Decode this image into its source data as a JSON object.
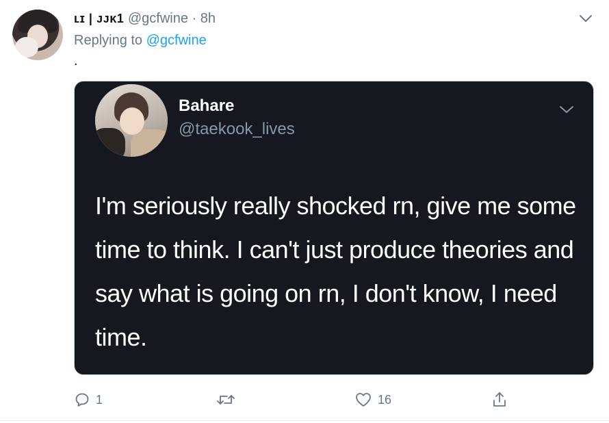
{
  "tweet": {
    "display_name": "ʟɪ | ᴊᴊᴋ1",
    "handle": "@gcfwine",
    "separator": "·",
    "time": "8h",
    "reply_prefix": "Replying to ",
    "reply_to": "@gcfwine",
    "text": "."
  },
  "quoted": {
    "name": "Bahare",
    "handle": "@taekook_lives",
    "text": "I'm seriously really shocked rn, give me some time to think. I can't just produce theories and say what is going on rn, I don't know, I need time."
  },
  "actions": {
    "reply_count": "1",
    "retweet_count": "",
    "like_count": "16"
  },
  "colors": {
    "link": "#1da1f2",
    "secondary_text": "#657786",
    "card_background": "#16181f"
  }
}
